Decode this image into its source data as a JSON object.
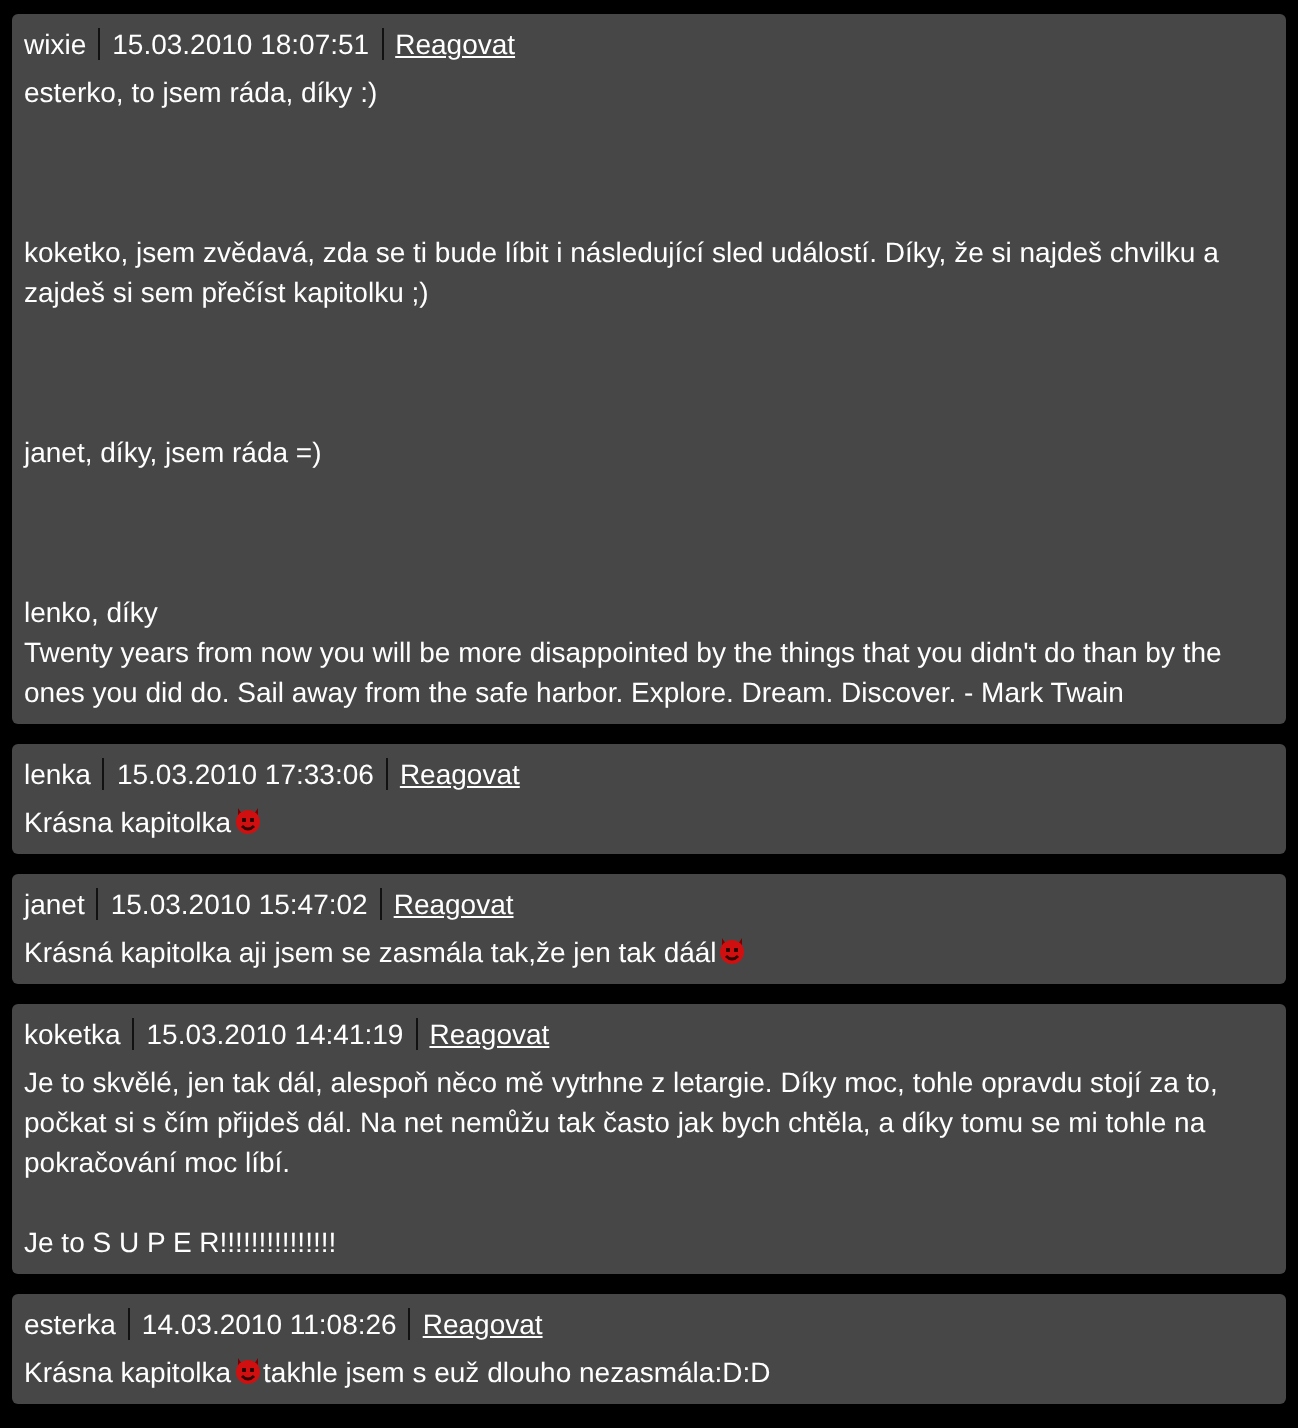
{
  "comments": [
    {
      "author": "wixie",
      "date": "15.03.2010 18:07:51",
      "reply": "Reagovat",
      "body": [
        {
          "kind": "text",
          "segments": [
            {
              "kind": "text",
              "text": "esterko, to jsem ráda, díky :)"
            }
          ]
        },
        {
          "kind": "blank"
        },
        {
          "kind": "blank"
        },
        {
          "kind": "blank"
        },
        {
          "kind": "text",
          "segments": [
            {
              "kind": "text",
              "text": "koketko, jsem zvědavá, zda se ti bude líbit i následující sled událostí. Díky, že si najdeš chvilku a zajdeš si sem přečíst kapitolku ;)"
            }
          ]
        },
        {
          "kind": "blank"
        },
        {
          "kind": "blank"
        },
        {
          "kind": "blank"
        },
        {
          "kind": "text",
          "segments": [
            {
              "kind": "text",
              "text": "janet, díky, jsem ráda =)"
            }
          ]
        },
        {
          "kind": "blank"
        },
        {
          "kind": "blank"
        },
        {
          "kind": "blank"
        },
        {
          "kind": "text",
          "segments": [
            {
              "kind": "text",
              "text": "lenko, díky"
            }
          ]
        },
        {
          "kind": "text",
          "segments": [
            {
              "kind": "text",
              "text": "Twenty years from now you will be more disappointed by the things that you didn't do than by the ones you did do. Sail away from the safe harbor. Explore. Dream. Discover. - Mark Twain"
            }
          ]
        }
      ]
    },
    {
      "author": "lenka",
      "date": "15.03.2010 17:33:06",
      "reply": "Reagovat",
      "body": [
        {
          "kind": "text",
          "segments": [
            {
              "kind": "text",
              "text": "Krásna kapitolka"
            },
            {
              "kind": "smiley"
            }
          ]
        }
      ]
    },
    {
      "author": "janet",
      "date": "15.03.2010 15:47:02",
      "reply": "Reagovat",
      "body": [
        {
          "kind": "text",
          "segments": [
            {
              "kind": "text",
              "text": "Krásná kapitolka aji jsem se zasmála tak,že jen tak dáál"
            },
            {
              "kind": "smiley"
            }
          ]
        }
      ]
    },
    {
      "author": "koketka",
      "date": "15.03.2010 14:41:19",
      "reply": "Reagovat",
      "body": [
        {
          "kind": "text",
          "segments": [
            {
              "kind": "text",
              "text": "Je to skvělé, jen tak dál, alespoň něco mě vytrhne z letargie. Díky moc, tohle opravdu stojí za to, počkat si s čím přijdeš dál. Na net nemůžu tak často jak bych chtěla, a díky tomu se mi tohle na pokračování moc líbí."
            }
          ]
        },
        {
          "kind": "blank"
        },
        {
          "kind": "text",
          "segments": [
            {
              "kind": "text",
              "text": "Je to S U P E R!!!!!!!!!!!!!!!"
            }
          ]
        }
      ]
    },
    {
      "author": "esterka",
      "date": "14.03.2010 11:08:26",
      "reply": "Reagovat",
      "body": [
        {
          "kind": "text",
          "segments": [
            {
              "kind": "text",
              "text": "Krásna kapitolka"
            },
            {
              "kind": "smiley"
            },
            {
              "kind": "text",
              "text": "takhle jsem s euž dlouho nezasmála:D:D"
            }
          ]
        }
      ]
    }
  ]
}
